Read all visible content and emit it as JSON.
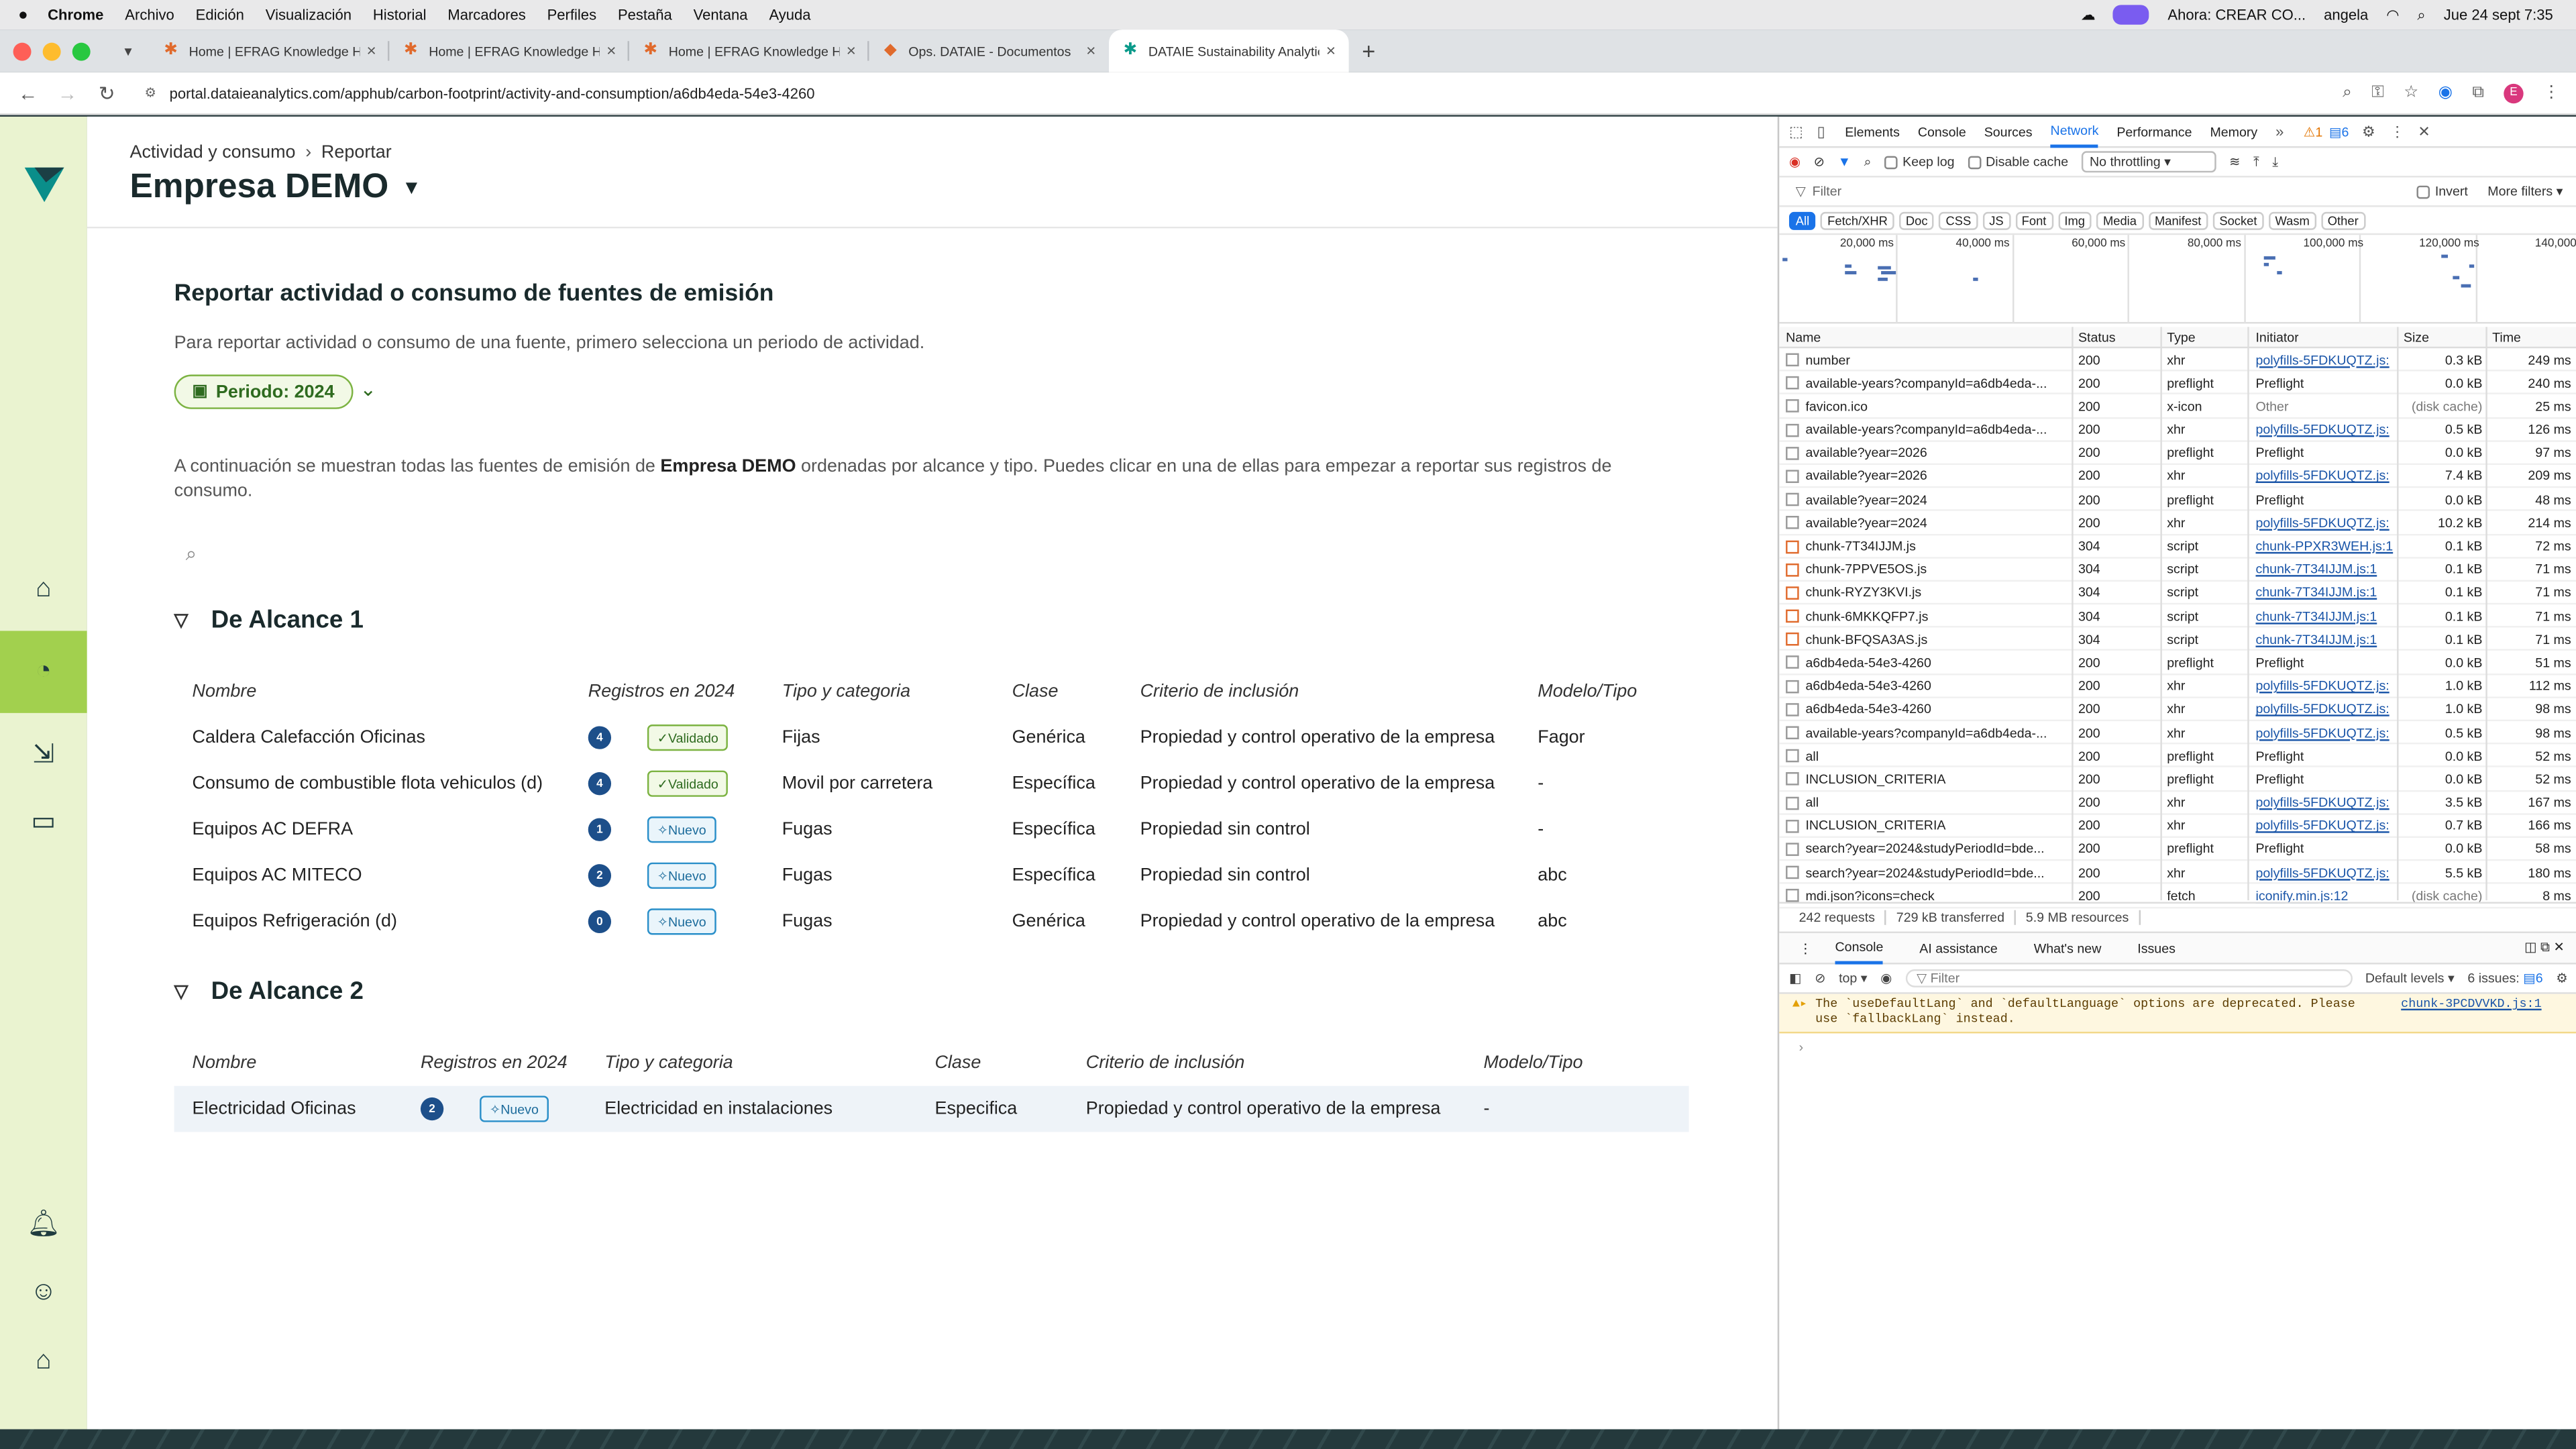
{
  "menubar": {
    "app": "Chrome",
    "items": [
      "Archivo",
      "Edición",
      "Visualización",
      "Historial",
      "Marcadores",
      "Perfiles",
      "Pestaña",
      "Ventana",
      "Ayuda"
    ],
    "now_playing": "Ahora: CREAR CO...",
    "user": "angela",
    "datetime": "Jue 24 sept 7:35"
  },
  "tabs": [
    {
      "title": "Home | EFRAG Knowledge Hub"
    },
    {
      "title": "Home | EFRAG Knowledge Hub"
    },
    {
      "title": "Home | EFRAG Knowledge Hub"
    },
    {
      "title": "Ops. DATAIE - Documentos"
    },
    {
      "title": "DATAIE Sustainability Analytics"
    }
  ],
  "address": {
    "url": "portal.dataieanalytics.com/apphub/carbon-footprint/activity-and-consumption/a6db4eda-54e3-4260"
  },
  "header": {
    "crumb1": "Actividad y consumo",
    "crumb2": "Reportar",
    "company": "Empresa DEMO"
  },
  "page": {
    "title": "Reportar actividad o consumo de fuentes de emisión",
    "intro": "Para reportar actividad o consumo de una fuente, primero selecciona un periodo de actividad.",
    "period": "Periodo: 2024",
    "desc_a": "A continuación se muestran todas las fuentes de emisión de ",
    "desc_b": "Empresa DEMO",
    "desc_c": " ordenadas por alcance y tipo. Puedes clicar en una de ellas para empezar a reportar sus registros de consumo."
  },
  "columns": {
    "nombre": "Nombre",
    "registros": "Registros en 2024",
    "tipo": "Tipo y categoria",
    "clase": "Clase",
    "criterio": "Criterio de inclusión",
    "modelo": "Modelo/Tipo"
  },
  "scope1": {
    "title": "De Alcance 1",
    "rows": [
      {
        "nombre": "Caldera Calefacción Oficinas",
        "count": "4",
        "status": "Validado",
        "tipo": "Fijas",
        "clase": "Genérica",
        "criterio": "Propiedad y control operativo de la empresa",
        "modelo": "Fagor"
      },
      {
        "nombre": "Consumo de combustible flota vehiculos (d)",
        "count": "4",
        "status": "Validado",
        "tipo": "Movil por carretera",
        "clase": "Específica",
        "criterio": "Propiedad y control operativo de la empresa",
        "modelo": "-"
      },
      {
        "nombre": "Equipos AC DEFRA",
        "count": "1",
        "status": "Nuevo",
        "tipo": "Fugas",
        "clase": "Específica",
        "criterio": "Propiedad sin control",
        "modelo": "-"
      },
      {
        "nombre": "Equipos AC MITECO",
        "count": "2",
        "status": "Nuevo",
        "tipo": "Fugas",
        "clase": "Específica",
        "criterio": "Propiedad sin control",
        "modelo": "abc"
      },
      {
        "nombre": "Equipos Refrigeración (d)",
        "count": "0",
        "status": "Nuevo",
        "tipo": "Fugas",
        "clase": "Genérica",
        "criterio": "Propiedad y control operativo de la empresa",
        "modelo": "abc"
      }
    ]
  },
  "scope2": {
    "title": "De Alcance 2",
    "rows": [
      {
        "nombre": "Electricidad Oficinas",
        "count": "2",
        "status": "Nuevo",
        "tipo": "Electricidad en instalaciones",
        "clase": "Especifica",
        "criterio": "Propiedad y control operativo de la empresa",
        "modelo": "-"
      }
    ]
  },
  "devtools": {
    "tabs": [
      "Elements",
      "Console",
      "Sources",
      "Network",
      "Performance",
      "Memory"
    ],
    "warnings": "1",
    "issues_count": "6",
    "keep_log": "Keep log",
    "disable_cache": "Disable cache",
    "throttling": "No throttling",
    "filter": "Filter",
    "invert": "Invert",
    "more_filters": "More filters",
    "chips": [
      "All",
      "Fetch/XHR",
      "Doc",
      "CSS",
      "JS",
      "Font",
      "Img",
      "Media",
      "Manifest",
      "Socket",
      "Wasm",
      "Other"
    ],
    "ticks": [
      "20,000 ms",
      "40,000 ms",
      "60,000 ms",
      "80,000 ms",
      "100,000 ms",
      "120,000 ms",
      "140,000"
    ],
    "cols": [
      "Name",
      "Status",
      "Type",
      "Initiator",
      "Size",
      "Time"
    ],
    "rows": [
      [
        "number",
        "200",
        "xhr",
        "polyfills-5FDKUQTZ.js:",
        "0.3 kB",
        "249 ms"
      ],
      [
        "available-years?companyId=a6db4eda-...",
        "200",
        "preflight",
        "Preflight",
        "0.0 kB",
        "240 ms"
      ],
      [
        "favicon.ico",
        "200",
        "x-icon",
        "Other",
        "(disk cache)",
        "25 ms"
      ],
      [
        "available-years?companyId=a6db4eda-...",
        "200",
        "xhr",
        "polyfills-5FDKUQTZ.js:",
        "0.5 kB",
        "126 ms"
      ],
      [
        "available?year=2026",
        "200",
        "preflight",
        "Preflight",
        "0.0 kB",
        "97 ms"
      ],
      [
        "available?year=2026",
        "200",
        "xhr",
        "polyfills-5FDKUQTZ.js:",
        "7.4 kB",
        "209 ms"
      ],
      [
        "available?year=2024",
        "200",
        "preflight",
        "Preflight",
        "0.0 kB",
        "48 ms"
      ],
      [
        "available?year=2024",
        "200",
        "xhr",
        "polyfills-5FDKUQTZ.js:",
        "10.2 kB",
        "214 ms"
      ],
      [
        "chunk-7T34IJJM.js",
        "304",
        "script",
        "chunk-PPXR3WEH.js:1",
        "0.1 kB",
        "72 ms"
      ],
      [
        "chunk-7PPVE5OS.js",
        "304",
        "script",
        "chunk-7T34IJJM.js:1",
        "0.1 kB",
        "71 ms"
      ],
      [
        "chunk-RYZY3KVI.js",
        "304",
        "script",
        "chunk-7T34IJJM.js:1",
        "0.1 kB",
        "71 ms"
      ],
      [
        "chunk-6MKKQFP7.js",
        "304",
        "script",
        "chunk-7T34IJJM.js:1",
        "0.1 kB",
        "71 ms"
      ],
      [
        "chunk-BFQSA3AS.js",
        "304",
        "script",
        "chunk-7T34IJJM.js:1",
        "0.1 kB",
        "71 ms"
      ],
      [
        "a6db4eda-54e3-4260",
        "200",
        "preflight",
        "Preflight",
        "0.0 kB",
        "51 ms"
      ],
      [
        "a6db4eda-54e3-4260",
        "200",
        "xhr",
        "polyfills-5FDKUQTZ.js:",
        "1.0 kB",
        "112 ms"
      ],
      [
        "a6db4eda-54e3-4260",
        "200",
        "xhr",
        "polyfills-5FDKUQTZ.js:",
        "1.0 kB",
        "98 ms"
      ],
      [
        "available-years?companyId=a6db4eda-...",
        "200",
        "xhr",
        "polyfills-5FDKUQTZ.js:",
        "0.5 kB",
        "98 ms"
      ],
      [
        "all",
        "200",
        "preflight",
        "Preflight",
        "0.0 kB",
        "52 ms"
      ],
      [
        "INCLUSION_CRITERIA",
        "200",
        "preflight",
        "Preflight",
        "0.0 kB",
        "52 ms"
      ],
      [
        "all",
        "200",
        "xhr",
        "polyfills-5FDKUQTZ.js:",
        "3.5 kB",
        "167 ms"
      ],
      [
        "INCLUSION_CRITERIA",
        "200",
        "xhr",
        "polyfills-5FDKUQTZ.js:",
        "0.7 kB",
        "166 ms"
      ],
      [
        "search?year=2024&studyPeriodId=bde...",
        "200",
        "preflight",
        "Preflight",
        "0.0 kB",
        "58 ms"
      ],
      [
        "search?year=2024&studyPeriodId=bde...",
        "200",
        "xhr",
        "polyfills-5FDKUQTZ.js:",
        "5.5 kB",
        "180 ms"
      ],
      [
        "mdi.json?icons=check",
        "200",
        "fetch",
        "iconify.min.js:12",
        "(disk cache)",
        "8 ms"
      ]
    ],
    "summary": [
      "242 requests",
      "729 kB transferred",
      "5.9 MB resources"
    ],
    "console_tabs": [
      "Console",
      "AI assistance",
      "What's new",
      "Issues"
    ],
    "context": "top",
    "levels": "Default levels",
    "issues": "6 issues:",
    "issues_n": "6",
    "warning_text": "The `useDefaultLang` and `defaultLanguage` options are deprecated. Please use `fallbackLang` instead.",
    "warning_link": "chunk-3PCDVVKD.js:1"
  }
}
